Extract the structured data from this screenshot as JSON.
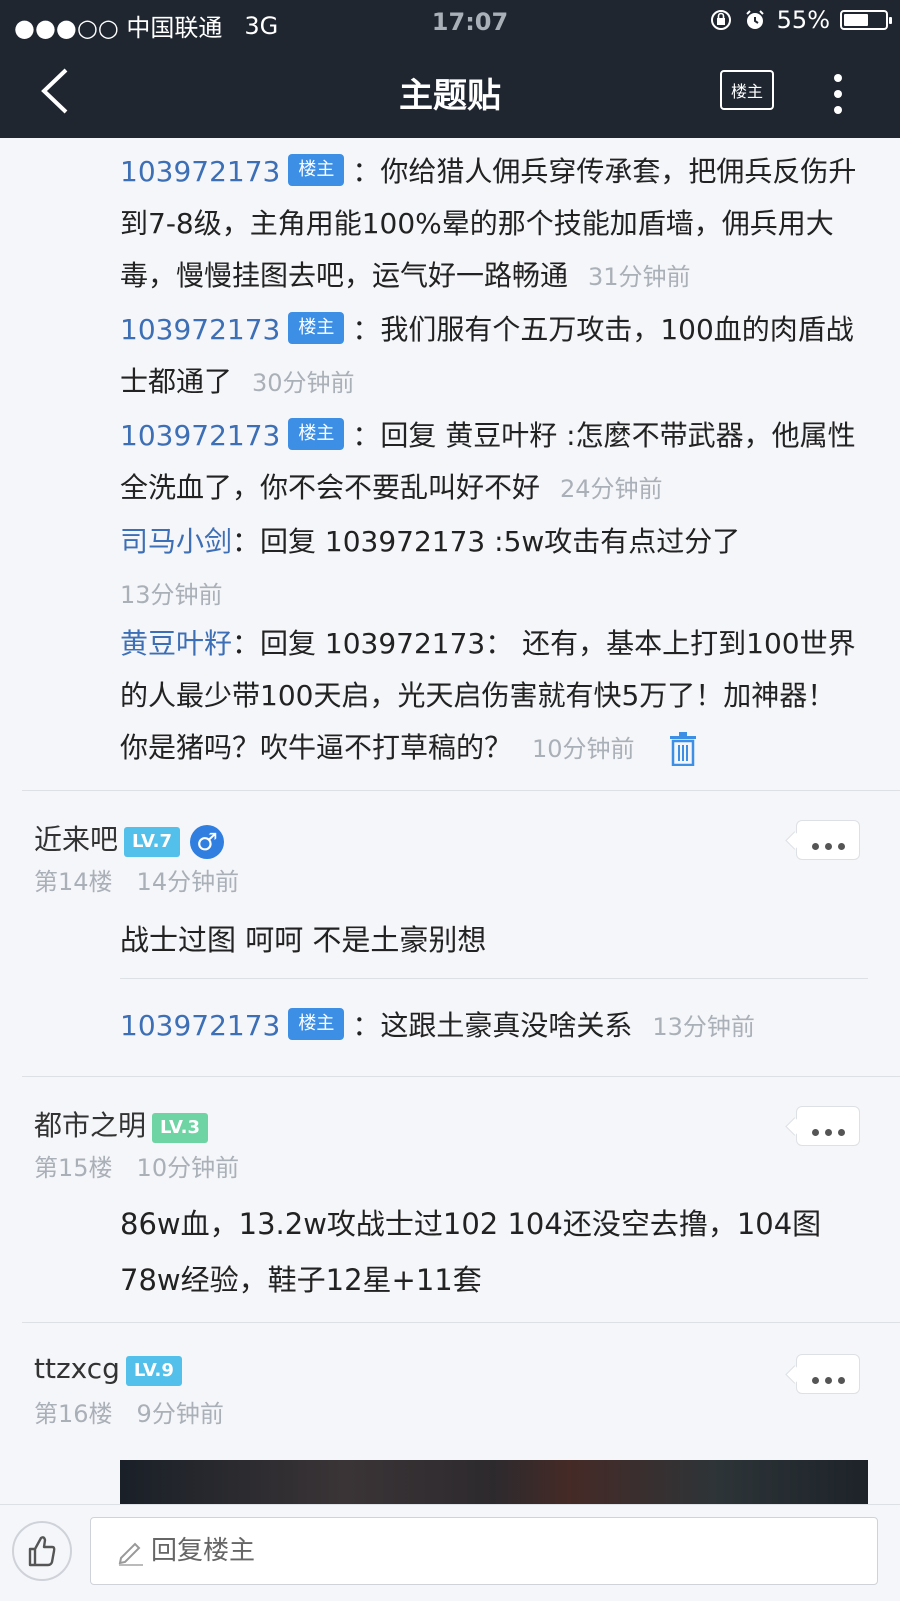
{
  "status": {
    "carrier": "●●●○○ 中国联通",
    "network": "3G",
    "time": "17:07",
    "battery": "55%"
  },
  "nav": {
    "title": "主题贴",
    "louzhu_label": "楼主"
  },
  "badge_louzhu": "楼主",
  "replies_top": [
    {
      "user": "103972173",
      "text": "：你给猎人佣兵穿传承套，把佣兵反伤升到7-8级，主角用能100%晕的那个技能加盾墙，佣兵用大毒，慢慢挂图去吧，运气好一路畅通",
      "time": "31分钟前"
    },
    {
      "user": "103972173",
      "text": "：我们服有个五万攻击，100血的肉盾战士都通了",
      "time": "30分钟前"
    },
    {
      "user": "103972173",
      "text": "：回复 黄豆叶籽 :怎麼不带武器，他属性全洗血了，你不会不要乱叫好不好",
      "time": "24分钟前"
    },
    {
      "user": "司马小剑",
      "text": "：回复 103972173 :5w攻击有点过分了",
      "time": "13分钟前"
    },
    {
      "user": "黄豆叶籽",
      "text": "：回复 103972173： 还有，基本上打到100世界的人最少带100天启，光天启伤害就有快5万了！加神器！你是猪吗？吹牛逼不打草稿的？",
      "time": "10分钟前"
    }
  ],
  "posts": [
    {
      "name": "近来吧",
      "level": "LV.7",
      "floor": "第14楼",
      "time": "14分钟前",
      "body": "战士过图 呵呵 不是土豪别想",
      "reply": {
        "user": "103972173",
        "text": "：这跟土豪真没啥关系",
        "time": "13分钟前"
      }
    },
    {
      "name": "都市之明",
      "level": "LV.3",
      "floor": "第15楼",
      "time": "10分钟前",
      "body": "86w血，13.2w攻战士过102 104还没空去撸，104图78w经验，鞋子12星+11套"
    },
    {
      "name": "ttzxcg",
      "level": "LV.9",
      "floor": "第16楼",
      "time": "9分钟前"
    }
  ],
  "bottom": {
    "reply_placeholder": "回复楼主"
  },
  "colors": {
    "header_bg": "#1f2630",
    "username": "#3d6fb6",
    "louzhu_badge": "#3d8fe6",
    "level_blue": "#52c0ea",
    "level_green": "#6fd4a4"
  }
}
